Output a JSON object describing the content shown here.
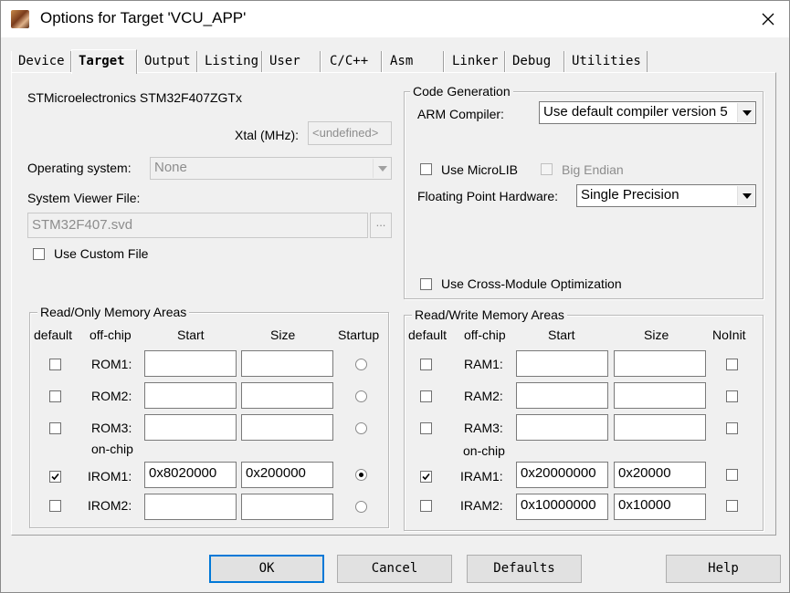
{
  "window": {
    "title": "Options for Target 'VCU_APP'"
  },
  "tabs": [
    {
      "label": "Device"
    },
    {
      "label": "Target"
    },
    {
      "label": "Output"
    },
    {
      "label": "Listing"
    },
    {
      "label": "User"
    },
    {
      "label": "C/C++"
    },
    {
      "label": "Asm"
    },
    {
      "label": "Linker"
    },
    {
      "label": "Debug"
    },
    {
      "label": "Utilities"
    }
  ],
  "active_tab": "Target",
  "device": {
    "name": "STMicroelectronics STM32F407ZGTx"
  },
  "xtal": {
    "label": "Xtal (MHz):",
    "value": "<undefined>"
  },
  "os": {
    "label": "Operating system:",
    "value": "None"
  },
  "svd": {
    "label": "System Viewer File:",
    "value": "STM32F407.svd",
    "browse": "...",
    "custom_label": "Use Custom File"
  },
  "codegen": {
    "title": "Code Generation",
    "compiler_label": "ARM Compiler:",
    "compiler_value": "Use default compiler version 5",
    "microlib_label": "Use MicroLIB",
    "bigendian_label": "Big Endian",
    "fpu_label": "Floating Point Hardware:",
    "fpu_value": "Single Precision",
    "crossmod_label": "Use Cross-Module Optimization"
  },
  "rom": {
    "title": "Read/Only Memory Areas",
    "headers": {
      "default": "default",
      "offchip": "off-chip",
      "start": "Start",
      "size": "Size",
      "startup": "Startup"
    },
    "onchip_label": "on-chip",
    "rows": [
      {
        "label": "ROM1:",
        "start": "",
        "size": ""
      },
      {
        "label": "ROM2:",
        "start": "",
        "size": ""
      },
      {
        "label": "ROM3:",
        "start": "",
        "size": ""
      },
      {
        "label": "IROM1:",
        "start": "0x8020000",
        "size": "0x200000"
      },
      {
        "label": "IROM2:",
        "start": "",
        "size": ""
      }
    ]
  },
  "ram": {
    "title": "Read/Write Memory Areas",
    "headers": {
      "default": "default",
      "offchip": "off-chip",
      "start": "Start",
      "size": "Size",
      "noinit": "NoInit"
    },
    "onchip_label": "on-chip",
    "rows": [
      {
        "label": "RAM1:",
        "start": "",
        "size": ""
      },
      {
        "label": "RAM2:",
        "start": "",
        "size": ""
      },
      {
        "label": "RAM3:",
        "start": "",
        "size": ""
      },
      {
        "label": "IRAM1:",
        "start": "0x20000000",
        "size": "0x20000"
      },
      {
        "label": "IRAM2:",
        "start": "0x10000000",
        "size": "0x10000"
      }
    ]
  },
  "buttons": {
    "ok": "OK",
    "cancel": "Cancel",
    "defaults": "Defaults",
    "help": "Help"
  },
  "colors": {
    "default_button_border": "#0078d7",
    "panel_bg": "#f0f0f0"
  }
}
